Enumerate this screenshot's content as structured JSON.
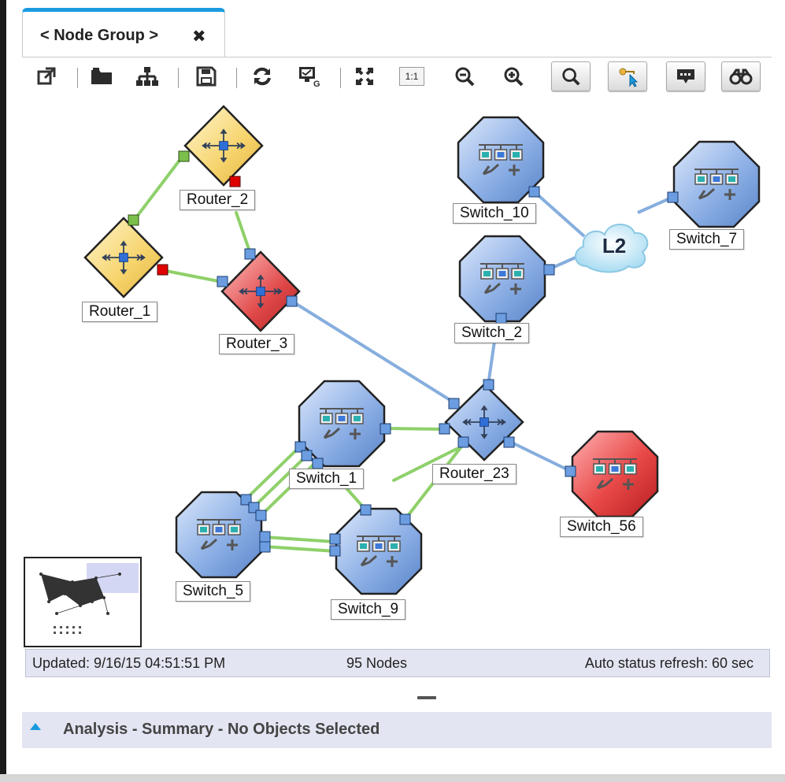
{
  "tab": {
    "title": "< Node Group >",
    "close_icon": "close-icon"
  },
  "toolbar": {
    "buttons": [
      "open-in-new-window-icon",
      "folder-open-icon",
      "hierarchy-icon",
      "save-icon",
      "refresh-icon",
      "status-poll-icon",
      "fit-to-window-icon",
      "actual-size-icon",
      "zoom-out-icon",
      "zoom-in-icon",
      "find-icon",
      "select-pointer-icon",
      "annotation-icon",
      "binoculars-icon"
    ],
    "actual_size_label": "1:1"
  },
  "nodes": {
    "router_2": "Router_2",
    "router_1": "Router_1",
    "router_3": "Router_3",
    "switch_10": "Switch_10",
    "switch_7": "Switch_7",
    "switch_2": "Switch_2",
    "cloud": "L2",
    "router_23": "Router_23",
    "switch_1": "Switch_1",
    "switch_56": "Switch_56",
    "switch_5": "Switch_5",
    "switch_9": "Switch_9"
  },
  "status_colors": {
    "normal": "#7aa3de",
    "critical": "#e04040",
    "warning": "#f6d36b",
    "link_ok": "#8fd06a",
    "link_l2": "#86aede"
  },
  "status_bar": {
    "updated": "Updated: 9/16/15 04:51:51 PM",
    "node_count": "95 Nodes",
    "refresh": "Auto status refresh: 60 sec"
  },
  "analysis": {
    "title": "Analysis - Summary - No Objects Selected"
  }
}
